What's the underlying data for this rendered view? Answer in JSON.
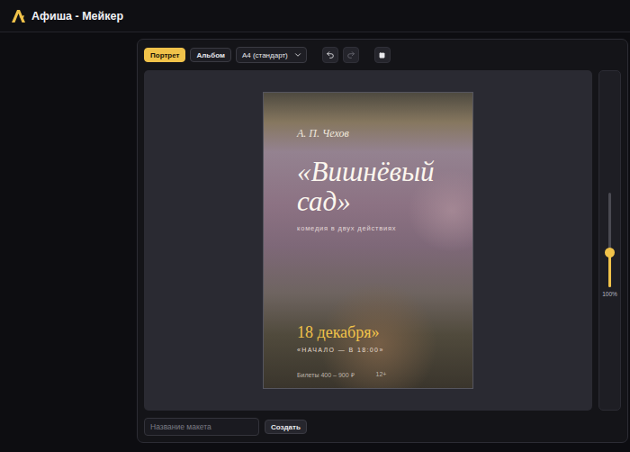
{
  "app": {
    "title": "Афиша - Мейкер"
  },
  "orientation": [
    {
      "label": "Портрет",
      "selected": true
    },
    {
      "label": "Альбом",
      "selected": false
    }
  ],
  "format": {
    "value": "A4 (стандарт)"
  },
  "history": {
    "undo_disabled": false,
    "redo_disabled": true
  },
  "poster": {
    "author": "А. П. Чехов",
    "title": "«Вишнёвый сад»",
    "subtitle": "комедия в двух действиях",
    "date": "18 декабря»",
    "start": "«НАЧАЛО — В 18:00»",
    "tickets": "Билеты 400 – 900 ₽",
    "age": "12+"
  },
  "zoom": {
    "level": 0.36,
    "reading": "100%"
  },
  "layout_name": {
    "placeholder": "Название макета",
    "value": ""
  },
  "create_button": {
    "label": "Создать"
  }
}
